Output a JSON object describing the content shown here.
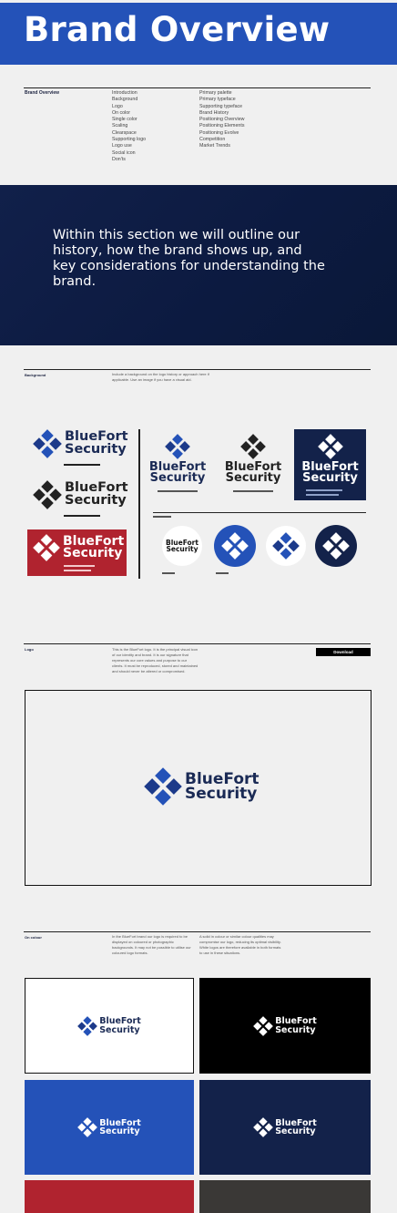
{
  "header": {
    "title": "Brand Overview"
  },
  "overview": {
    "label": "Brand Overview",
    "col1": [
      "Introduction",
      "Background",
      "Logo",
      "On color",
      "Single color",
      "Scaling",
      "Clearspace",
      "Supporting logo",
      "Logo use",
      "Social icon",
      "Don'ts"
    ],
    "col2": [
      "Primary palette",
      "Primary typeface",
      "Supporting typeface",
      "Brand History",
      "Positioning Overview",
      "Positioning Elements",
      "Positioning Evolve",
      "Competition",
      "Market Trends"
    ]
  },
  "intro": {
    "text": "Within this section we will outline our history, how the brand shows up, and key considerations for understanding the brand."
  },
  "background_section": {
    "label": "Background",
    "description": "Include a background on the logo history or approach here if applicable. Use an image if you have a visual aid."
  },
  "brand": {
    "line1": "BlueFort",
    "line2": "Security"
  },
  "logo_section": {
    "label": "Logo",
    "description": "This is the BlueFort logo. It is the principal visual icon of our identity and brand. It is our signature that represents our core values and purpose to our clients. It must be reproduced, stored and maintained and should never be altered or compromised.",
    "download_label": "Download"
  },
  "on_colour_section": {
    "label": "On colour",
    "description_left": "In the BlueFort brand our logo is required to be displayed on coloured or photographic backgrounds. It may not be possible to utilise our coloured logo formats.",
    "description_right": "A solid in colour or similar colour qualities may compromise our logo, reducing its optimal visibility. White logos are therefore available in both formats to use in these situations."
  },
  "colors": {
    "blue": "#2452b8",
    "navy": "#13224a",
    "red": "#b0232f",
    "charcoal": "#3a3836",
    "black": "#000000",
    "white": "#ffffff"
  }
}
